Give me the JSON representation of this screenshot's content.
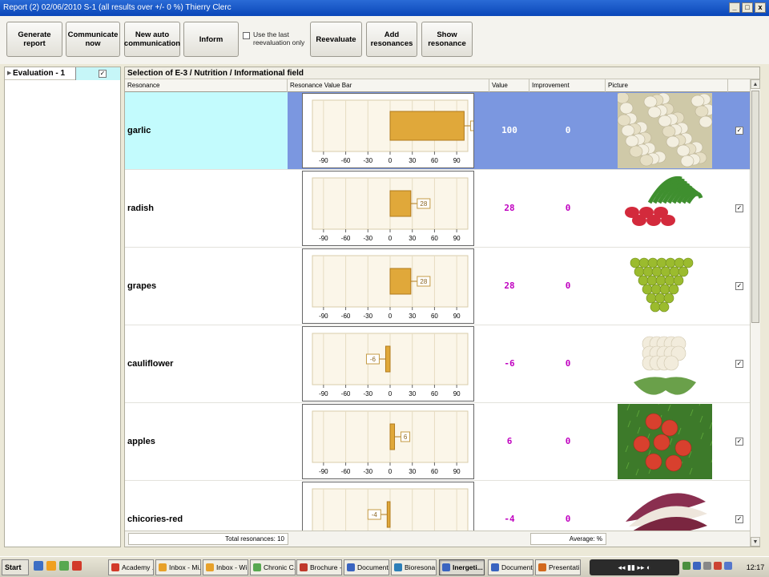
{
  "window": {
    "title": "Report (2) 02/06/2010 S-1 (all results over +/- 0 %) Thierry Clerc",
    "buttons": [
      "_",
      "□",
      "x"
    ]
  },
  "toolbar": {
    "generate_report": "Generate report",
    "communicate_now": "Communicate now",
    "new_auto_communication": "New auto communication",
    "inform": "Inform",
    "use_last_reevaluation": "Use the last reevaluation only",
    "reevaluate": "Reevaluate",
    "add_resonances": "Add resonances",
    "show_resonance": "Show resonance"
  },
  "left_panel": {
    "evaluation_label": "Evaluation - 1",
    "checked": true
  },
  "main": {
    "header": "Selection of E-3 / Nutrition / Informational field",
    "columns": {
      "resonance": "Resonance",
      "bar": "Resonance Value Bar",
      "value": "Value",
      "improvement": "Improvement",
      "picture": "Picture"
    },
    "ticks": [
      "-90",
      "-60",
      "-30",
      "0",
      "30",
      "60",
      "90"
    ],
    "rows": [
      {
        "name": "garlic",
        "value": "100",
        "improvement": "0",
        "selected": true,
        "picture_icon": "garlic-image"
      },
      {
        "name": "radish",
        "value": "28",
        "improvement": "0",
        "selected": false,
        "picture_icon": "radish-image"
      },
      {
        "name": "grapes",
        "value": "28",
        "improvement": "0",
        "selected": false,
        "picture_icon": "grapes-image"
      },
      {
        "name": "cauliflower",
        "value": "-6",
        "improvement": "0",
        "selected": false,
        "picture_icon": "cauliflower-image"
      },
      {
        "name": "apples",
        "value": "6",
        "improvement": "0",
        "selected": false,
        "picture_icon": "apples-image"
      },
      {
        "name": "chicories-red",
        "value": "-4",
        "improvement": "0",
        "selected": false,
        "picture_icon": "chicory-image"
      }
    ],
    "footer": {
      "total": "Total resonances: 10",
      "average": "Average:  %"
    }
  },
  "taskbar": {
    "start": "Start",
    "tasks": [
      "Academy ...",
      "Inbox - Mi...",
      "Inbox - Wi...",
      "Chronic C...",
      "Brochure -...",
      "Document...",
      "Bioresona...",
      "Inergeti...",
      "Document...",
      "Presentati..."
    ],
    "active_task": "Inergeti...",
    "clock": "12:17"
  },
  "colors": {
    "selected_row": "#7b97e0",
    "selected_name_cell": "#c3fbfd",
    "value_text": "#c000c0",
    "bar_fill": "#e0a83a"
  }
}
